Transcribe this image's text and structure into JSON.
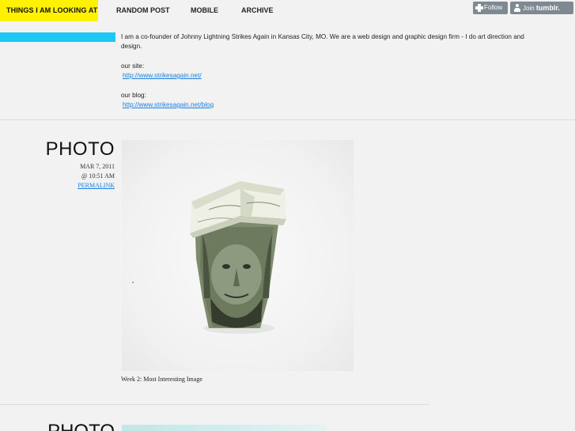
{
  "nav": {
    "title": "THINGS I AM LOOKING AT",
    "random_post": "RANDOM POST",
    "mobile": "MOBILE",
    "archive": "ARCHIVE"
  },
  "tumblr": {
    "follow_label": "Follow",
    "join_label": "Join",
    "join_brand": "tumblr."
  },
  "description": {
    "intro": "I am a co-founder of Johnny Lightning Strikes Again in Kansas City, MO. We are a web design and graphic design firm - I do art direction and design.",
    "site_label": "our site:",
    "site_url": "http://www.strikesagain.net/",
    "blog_label": "our blog:",
    "blog_url": "http://www.strikesagain.net/blog"
  },
  "posts": [
    {
      "type": "PHOTO",
      "date": "MAR 7, 2011",
      "time": "@ 10:51 AM",
      "permalink": "PERMALINK",
      "caption": "Week 2: Most Interesting Image"
    },
    {
      "type": "PHOTO"
    }
  ],
  "colors": {
    "accent_yellow": "#fff200",
    "accent_cyan": "#1ec8f5",
    "link": "#1a7fe0",
    "background": "#f2f2f2"
  }
}
